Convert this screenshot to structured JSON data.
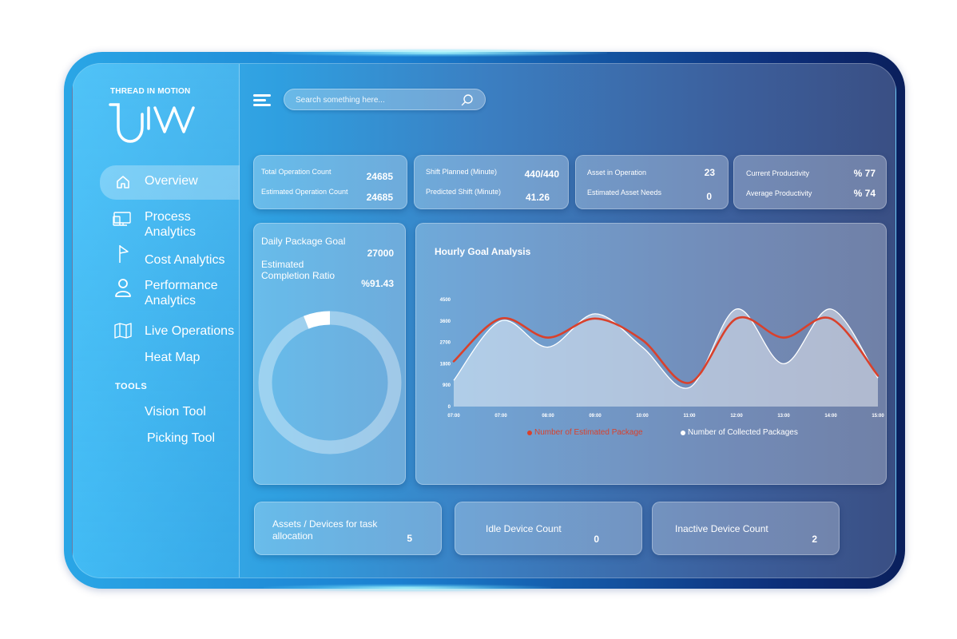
{
  "brand": {
    "name": "THREAD IN MOTION"
  },
  "sidebar": {
    "items": [
      {
        "label": "Overview",
        "icon": "home-icon"
      },
      {
        "label": "Process Analytics",
        "icon": "monitor-icon"
      },
      {
        "label": "Cost Analytics",
        "icon": "flag-icon"
      },
      {
        "label": "Performance Analytics",
        "icon": "user-icon"
      },
      {
        "label": "Live Operations",
        "icon": "map-icon"
      },
      {
        "label": "Heat Map"
      }
    ],
    "tools_heading": "TOOLS",
    "tools": [
      {
        "label": "Vision Tool"
      },
      {
        "label": "Picking Tool"
      }
    ]
  },
  "search": {
    "placeholder": "Search something here..."
  },
  "kpis": {
    "operation": {
      "total_label": "Total Operation Count",
      "total_value": "24685",
      "estimated_label": "Estimated Operation Count",
      "estimated_value": "24685"
    },
    "shift": {
      "planned_label": "Shift Planned (Minute)",
      "planned_value": "440/440",
      "predicted_label": "Predicted Shift (Minute)",
      "predicted_value": "41.26"
    },
    "assets": {
      "operation_label": "Asset in Operation",
      "operation_value": "23",
      "needs_label": "Estimated Asset Needs",
      "needs_value": "0"
    },
    "productivity": {
      "current_label": "Current Productivity",
      "current_value": "% 77",
      "average_label": "Average Productivity",
      "average_value": "% 74"
    }
  },
  "daily": {
    "goal_label": "Daily Package Goal",
    "goal_value": "27000",
    "ratio_label": "Estimated Completion Ratio",
    "ratio_value": "%91.43",
    "donut_fraction": 0.06
  },
  "colors": {
    "estimated": "#d9412c",
    "collected": "#ffffff"
  },
  "chart_data": {
    "type": "area",
    "title": "Hourly Goal Analysis",
    "x": [
      "07:00",
      "07:00",
      "08:00",
      "09:00",
      "10:00",
      "11:00",
      "12:00",
      "13:00",
      "14:00",
      "15:00"
    ],
    "yticks": [
      0,
      900,
      1800,
      2700,
      3600,
      4500
    ],
    "ylim": [
      0,
      4500
    ],
    "series": [
      {
        "name": "Number of Estimated Package",
        "type": "line",
        "color": "#d9412c",
        "values": [
          1900,
          3700,
          2900,
          3700,
          2800,
          1000,
          3700,
          2900,
          3700,
          1300
        ]
      },
      {
        "name": "Number of Collected Packages",
        "type": "area",
        "color": "#ffffff",
        "values": [
          1100,
          3600,
          2500,
          3900,
          2500,
          800,
          4100,
          1800,
          4100,
          1200
        ]
      }
    ],
    "legend": "bottom"
  },
  "bottom": {
    "assets_label": "Assets / Devices for task allocation",
    "assets_value": "5",
    "idle_label": "Idle Device Count",
    "idle_value": "0",
    "inactive_label": "Inactive Device Count",
    "inactive_value": "2"
  }
}
